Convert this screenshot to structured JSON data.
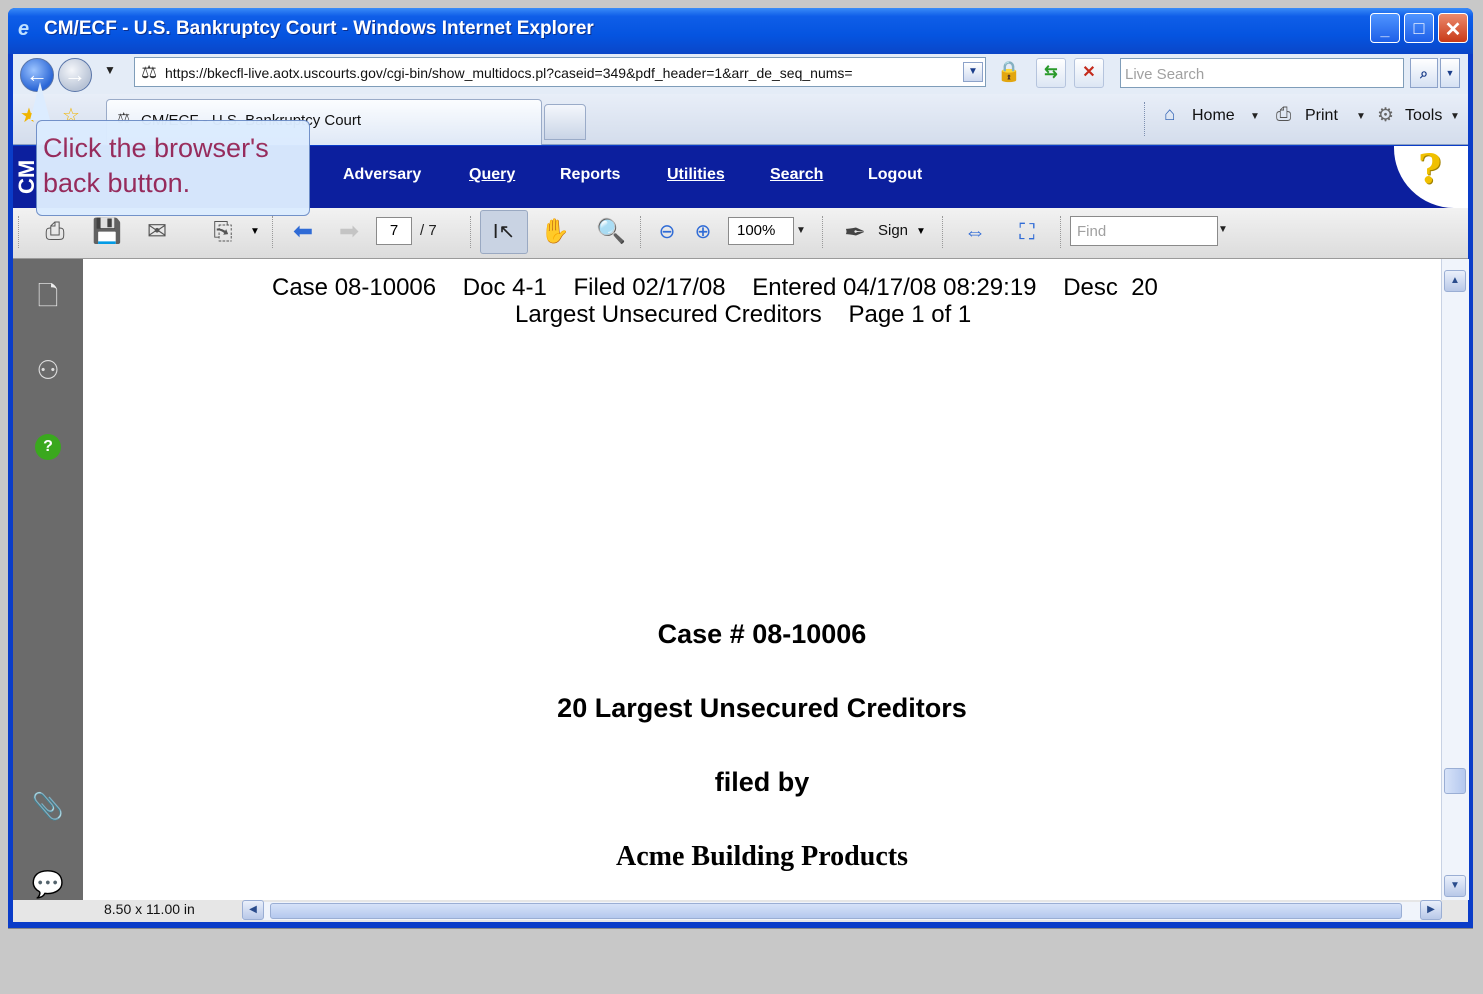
{
  "window": {
    "title": "CM/ECF - U.S. Bankruptcy Court - Windows Internet Explorer",
    "icon": "ie-logo-icon",
    "controls": [
      "minimize-icon",
      "maximize-icon",
      "close-icon"
    ]
  },
  "navbar": {
    "address": "https://bkecfl-live.aotx.uscourts.gov/cgi-bin/show_multidocs.pl?caseid=349&pdf_header=1&arr_de_seq_nums=",
    "search_placeholder": "Live Search"
  },
  "tabs": {
    "active_title": "CM/ECF - U.S. Bankruptcy Court"
  },
  "command_bar": {
    "home": "Home",
    "print": "Print",
    "tools": "Tools"
  },
  "cmecf_menu": {
    "logo": "CM",
    "items": [
      "Adversary",
      "Query",
      "Reports",
      "Utilities",
      "Search",
      "Logout"
    ],
    "help": "?"
  },
  "pdf_toolbar": {
    "current_page": "7",
    "total_pages": "/ 7",
    "zoom": "100%",
    "sign": "Sign",
    "find_placeholder": "Find"
  },
  "document": {
    "header_line1": "Case 08-10006    Doc 4-1    Filed 02/17/08    Entered 04/17/08 08:29:19    Desc  20",
    "header_line2": "Largest Unsecured Creditors    Page 1 of 1",
    "case_number": "Case # 08-10006",
    "title": "20 Largest Unsecured Creditors",
    "filed_by": "filed by",
    "company": "Acme Building Products",
    "page_size": "8.50 x 11.00 in"
  },
  "callout": {
    "text": "Click the browser's back button."
  }
}
